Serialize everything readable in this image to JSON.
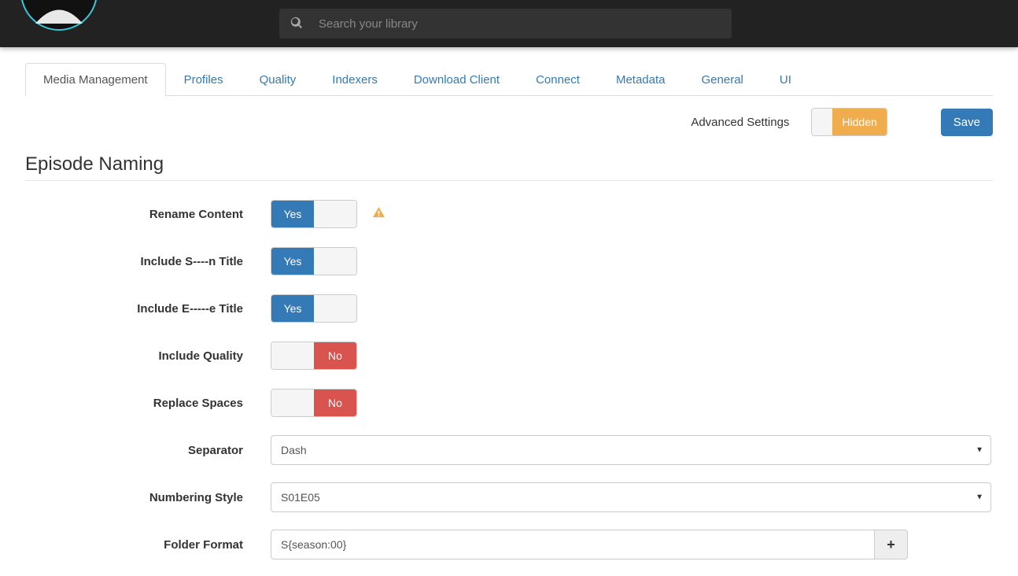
{
  "search": {
    "placeholder": "Search your library"
  },
  "tabs": [
    {
      "label": "Media Management",
      "active": true
    },
    {
      "label": "Profiles"
    },
    {
      "label": "Quality"
    },
    {
      "label": "Indexers"
    },
    {
      "label": "Download Client"
    },
    {
      "label": "Connect"
    },
    {
      "label": "Metadata"
    },
    {
      "label": "General"
    },
    {
      "label": "UI"
    }
  ],
  "topright": {
    "advanced_label": "Advanced Settings",
    "advanced_toggle": "Hidden",
    "save_label": "Save"
  },
  "section_title": "Episode Naming",
  "toggle_text": {
    "yes": "Yes",
    "no": "No"
  },
  "rows": {
    "rename": {
      "label": "Rename Content",
      "value": "Yes",
      "warn": true
    },
    "include_season_title": {
      "label": "Include S----n Title",
      "value": "Yes"
    },
    "include_episode_title": {
      "label": "Include E-----e Title",
      "value": "Yes"
    },
    "include_quality": {
      "label": "Include Quality",
      "value": "No"
    },
    "replace_spaces": {
      "label": "Replace Spaces",
      "value": "No"
    },
    "separator": {
      "label": "Separator",
      "value": "Dash"
    },
    "numbering_style": {
      "label": "Numbering Style",
      "value": "S01E05"
    },
    "folder_format": {
      "label": "Folder Format",
      "value": "S{season:00}"
    }
  }
}
